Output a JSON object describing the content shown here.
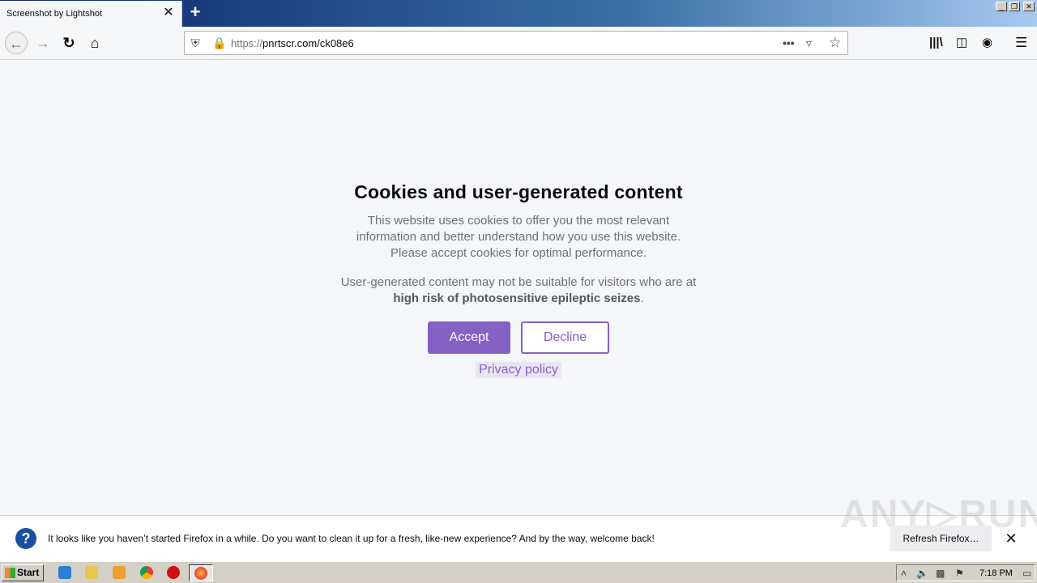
{
  "browser": {
    "tab_title": "Screenshot by Lightshot",
    "tab_close": "✕",
    "new_tab": "+",
    "url_scheme": "https://",
    "url_host": "pnrtscr.com/ck08e6",
    "window_controls": [
      "_",
      "❐",
      "✕"
    ]
  },
  "consent": {
    "title": "Cookies and user-generated content",
    "paragraph1_line1": "This website uses cookies to offer you the most relevant",
    "paragraph1_line2": "information and better understand how you use this website.",
    "paragraph1_line3": "Please accept cookies for optimal performance.",
    "paragraph2_line1": "User-generated content may not be suitable for visitors who are at",
    "paragraph2_bold": "high risk of photosensitive epileptic seizes",
    "paragraph2_end": ".",
    "accept_label": "Accept",
    "decline_label": "Decline",
    "privacy_label": "Privacy policy",
    "accent_color": "#8561c5"
  },
  "notification": {
    "icon": "?",
    "text": "It looks like you haven’t started Firefox in a while. Do you want to clean it up for a fresh, like-new experience? And by the way, welcome back!",
    "refresh_label": "Refresh Firefox…",
    "close": "✕",
    "watermark": "ANY▷RUN"
  },
  "taskbar": {
    "start_label": "Start",
    "clock": "7:18 PM"
  }
}
